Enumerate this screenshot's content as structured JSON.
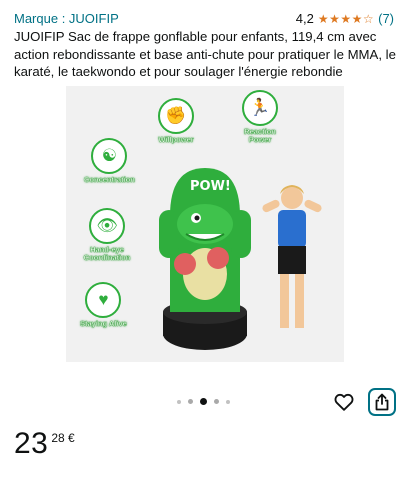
{
  "product": {
    "brand_label": "Marque : JUOIFIP",
    "rating_value": "4,2",
    "rating_stars": "★★★★☆",
    "rating_count": "(7)",
    "title": "JUOIFIP Sac de frappe gonflable pour enfants, 119,4 cm avec action rebondissante et base anti-chute pour pratiquer le MMA, le karaté, le taekwondo et pour soulager l'énergie rebondie",
    "price_whole": "23",
    "price_fraction": "28 €"
  },
  "image": {
    "badges": {
      "willpower": "Willpower",
      "reaction": "Reaction Power",
      "concentration": "Concentration",
      "handeye": "Hand-eye Coordination",
      "alive": "Staying Alive"
    },
    "pow_text": "POW!",
    "colors": {
      "green": "#2fae3d",
      "dark_green": "#1f8a2a",
      "base": "#1a1a1a"
    }
  },
  "carousel": {
    "total": 5,
    "active_index": 2
  },
  "icons": {
    "wishlist": "heart-icon",
    "share": "share-icon"
  },
  "colors": {
    "link": "#007185",
    "stars": "#de7921",
    "text": "#0f1111"
  }
}
